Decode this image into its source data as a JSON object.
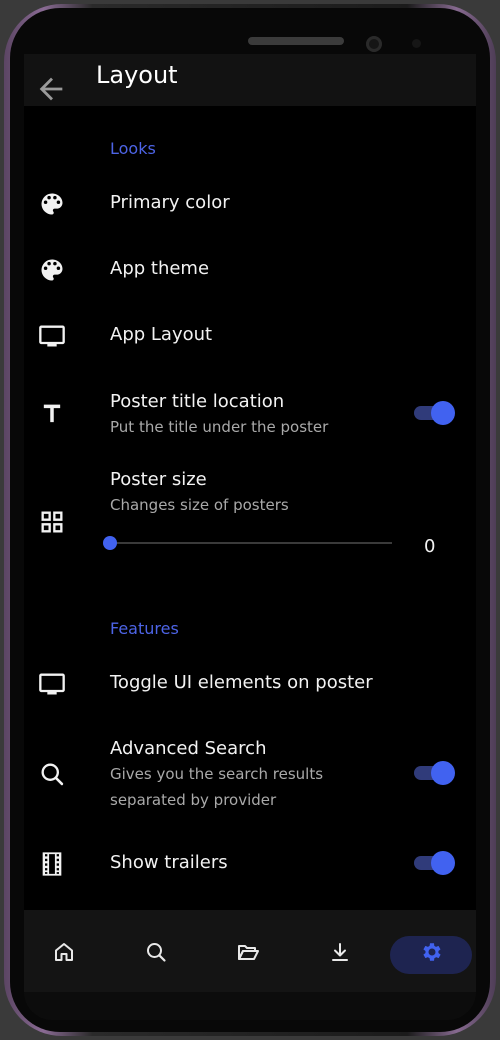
{
  "appbar": {
    "title": "Layout",
    "back_icon": "arrow-left-icon"
  },
  "sections": {
    "looks": "Looks",
    "features": "Features"
  },
  "rows": {
    "primary_color": {
      "title": "Primary color",
      "icon": "palette-icon"
    },
    "app_theme": {
      "title": "App theme",
      "icon": "palette-icon"
    },
    "app_layout": {
      "title": "App Layout",
      "icon": "monitor-icon"
    },
    "poster_title": {
      "title": "Poster title location",
      "subtitle": "Put the title under the poster",
      "icon": "text-icon",
      "toggle": true
    },
    "poster_size": {
      "title": "Poster size",
      "subtitle": "Changes size of posters",
      "icon": "grid-icon",
      "slider_value": "0",
      "slider_fraction": 0
    },
    "toggle_ui": {
      "title": "Toggle UI elements on poster",
      "icon": "monitor-icon"
    },
    "advanced_search": {
      "title": "Advanced Search",
      "subtitle_line1": "Gives you the search results",
      "subtitle_line2": "separated by provider",
      "icon": "search-icon",
      "toggle": true
    },
    "show_trailers": {
      "title": "Show trailers",
      "icon": "film-icon",
      "toggle": true
    }
  },
  "bottom_nav": {
    "items": [
      "home-icon",
      "search-icon",
      "folder-open-icon",
      "download-icon",
      "gear-icon"
    ],
    "active": "gear-icon"
  },
  "colors": {
    "accent": "#4162f0",
    "section_label": "#4d64e6",
    "background": "#000000",
    "appbar": "#121212"
  }
}
